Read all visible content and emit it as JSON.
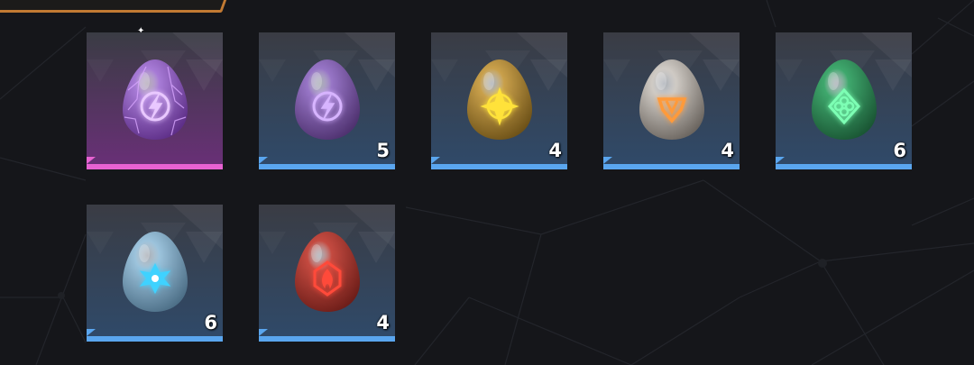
{
  "slots": [
    {
      "name": "electric-egg-selected",
      "count": "",
      "selected": true,
      "egg_main": "#a77bd6",
      "egg_dark": "#5e2f88",
      "symbol_color": "#e9c8ff",
      "symbol": "lightning-icon",
      "bar_color": "#e762d2",
      "bg_top": "#3a3c44",
      "bg_bottom": "#6a2f78"
    },
    {
      "name": "electric-egg",
      "count": "5",
      "selected": false,
      "egg_main": "#9775c6",
      "egg_dark": "#4f3270",
      "symbol_color": "#d7b4ff",
      "symbol": "lightning-icon",
      "bar_color": "#5aa6ef",
      "bg_top": "#3a3c44",
      "bg_bottom": "#2f4a6a"
    },
    {
      "name": "ground-egg",
      "count": "4",
      "selected": false,
      "egg_main": "#c9a04b",
      "egg_dark": "#6e5218",
      "symbol_color": "#ffe23a",
      "symbol": "compass-star-icon",
      "bar_color": "#5aa6ef",
      "bg_top": "#3a3c44",
      "bg_bottom": "#2f4a6a"
    },
    {
      "name": "neutral-egg",
      "count": "4",
      "selected": false,
      "egg_main": "#cfcac4",
      "egg_dark": "#6c6660",
      "symbol_color": "#ff9a3a",
      "symbol": "fist-icon",
      "bar_color": "#5aa6ef",
      "bg_top": "#3a3c44",
      "bg_bottom": "#2f4a6a"
    },
    {
      "name": "grass-egg",
      "count": "6",
      "selected": false,
      "egg_main": "#3fa86d",
      "egg_dark": "#1a5634",
      "symbol_color": "#7dffb4",
      "symbol": "leaf-clover-icon",
      "bar_color": "#5aa6ef",
      "bg_top": "#3a3c44",
      "bg_bottom": "#2f4a6a"
    },
    {
      "name": "ice-egg",
      "count": "6",
      "selected": false,
      "egg_main": "#9cc3dc",
      "egg_dark": "#4d6f87",
      "symbol_color": "#3fd2ff",
      "symbol": "snowflake-icon",
      "bar_color": "#5aa6ef",
      "bg_top": "#3a3c44",
      "bg_bottom": "#2f4a6a"
    },
    {
      "name": "fire-egg",
      "count": "4",
      "selected": false,
      "egg_main": "#c44a40",
      "egg_dark": "#6e1e19",
      "symbol_color": "#ff4a3a",
      "symbol": "flame-icon",
      "bar_color": "#5aa6ef",
      "bg_top": "#3a3c44",
      "bg_bottom": "#2f4a6a"
    }
  ]
}
